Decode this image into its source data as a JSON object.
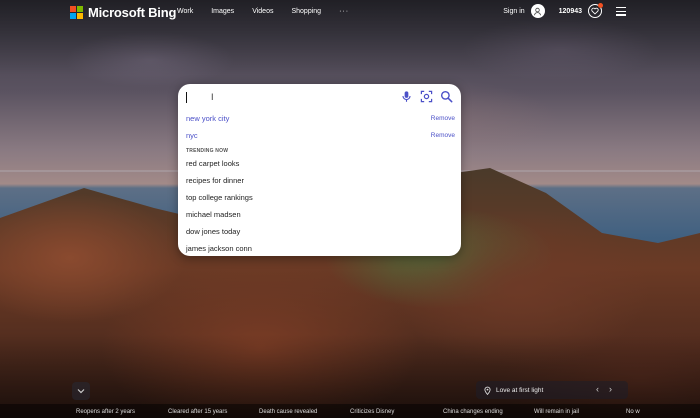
{
  "header": {
    "brand": "Microsoft Bing",
    "nav": [
      "Work",
      "Images",
      "Videos",
      "Shopping"
    ],
    "more_label": "···",
    "sign_in": "Sign in",
    "points": "120943",
    "brand_colors": [
      "#f25022",
      "#7fba00",
      "#00a4ef",
      "#ffb900"
    ]
  },
  "search": {
    "query": "",
    "placeholder": "",
    "accent": "#4b50c8",
    "icons": [
      "microphone-icon",
      "visual-search-icon",
      "search-icon"
    ]
  },
  "recent": [
    {
      "text": "new york city",
      "action": "Remove"
    },
    {
      "text": "nyc",
      "action": "Remove"
    }
  ],
  "trending": {
    "heading": "TRENDING NOW",
    "items": [
      "red carpet looks",
      "recipes for dinner",
      "top college rankings",
      "michael madsen",
      "dow jones today",
      "james jackson conn"
    ]
  },
  "image_info": {
    "location_label": "Love at first light"
  },
  "news": [
    "Reopens after 2 years",
    "Cleared after 15 years",
    "Death cause revealed",
    "Criticizes Disney",
    "China changes ending",
    "Will remain in jail",
    "No w"
  ]
}
